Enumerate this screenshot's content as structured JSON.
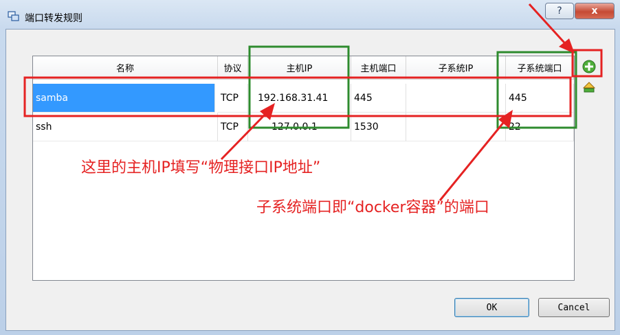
{
  "window": {
    "title": "端口转发规则",
    "help_glyph": "?",
    "close_glyph": "x"
  },
  "table": {
    "columns": [
      "名称",
      "协议",
      "主机IP",
      "主机端口",
      "子系统IP",
      "子系统端口"
    ],
    "rows": [
      [
        "samba",
        "TCP",
        "192.168.31.41",
        "445",
        "",
        "445"
      ],
      [
        "ssh",
        "TCP",
        "127.0.0.1",
        "1530",
        "",
        "22"
      ]
    ],
    "selected_row": 0
  },
  "side_buttons": {
    "add_icon": "add-rule-icon",
    "remove_icon": "remove-rule-icon"
  },
  "buttons": {
    "ok": "OK",
    "cancel": "Cancel"
  },
  "annotations": {
    "host_ip_note": "这里的主机IP填写“物理接口IP地址”",
    "guest_port_note": "子系统端口即“docker容器”的端口"
  },
  "colors": {
    "annotation_red": "#e52222",
    "annotation_green": "#2e8b2e",
    "selection_blue": "#3399ff"
  }
}
